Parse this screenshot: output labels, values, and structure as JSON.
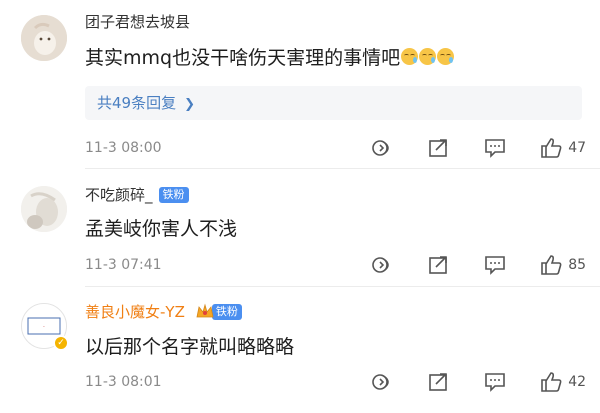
{
  "comments": [
    {
      "username": "团子君想去坡县",
      "text": "其实mmq也没干啥伤天害理的事情吧",
      "emojis": [
        "crying-laugh",
        "crying-laugh",
        "crying-laugh"
      ],
      "replies_label": "共49条回复",
      "time": "11-3 08:00",
      "likes": "47"
    },
    {
      "username": "不吃颜碎_",
      "badge": "铁粉",
      "text": "孟美岐你害人不浅",
      "time": "11-3 07:41",
      "likes": "85"
    },
    {
      "username": "善良小魔女-YZ",
      "badge": "铁粉",
      "text": "以后那个名字就叫略略略",
      "time": "11-3 08:01",
      "likes": "42"
    }
  ],
  "colors": {
    "accent_link": "#4a7fc1",
    "vip_name": "#f07f13",
    "badge_bg": "#4b8ff0"
  }
}
